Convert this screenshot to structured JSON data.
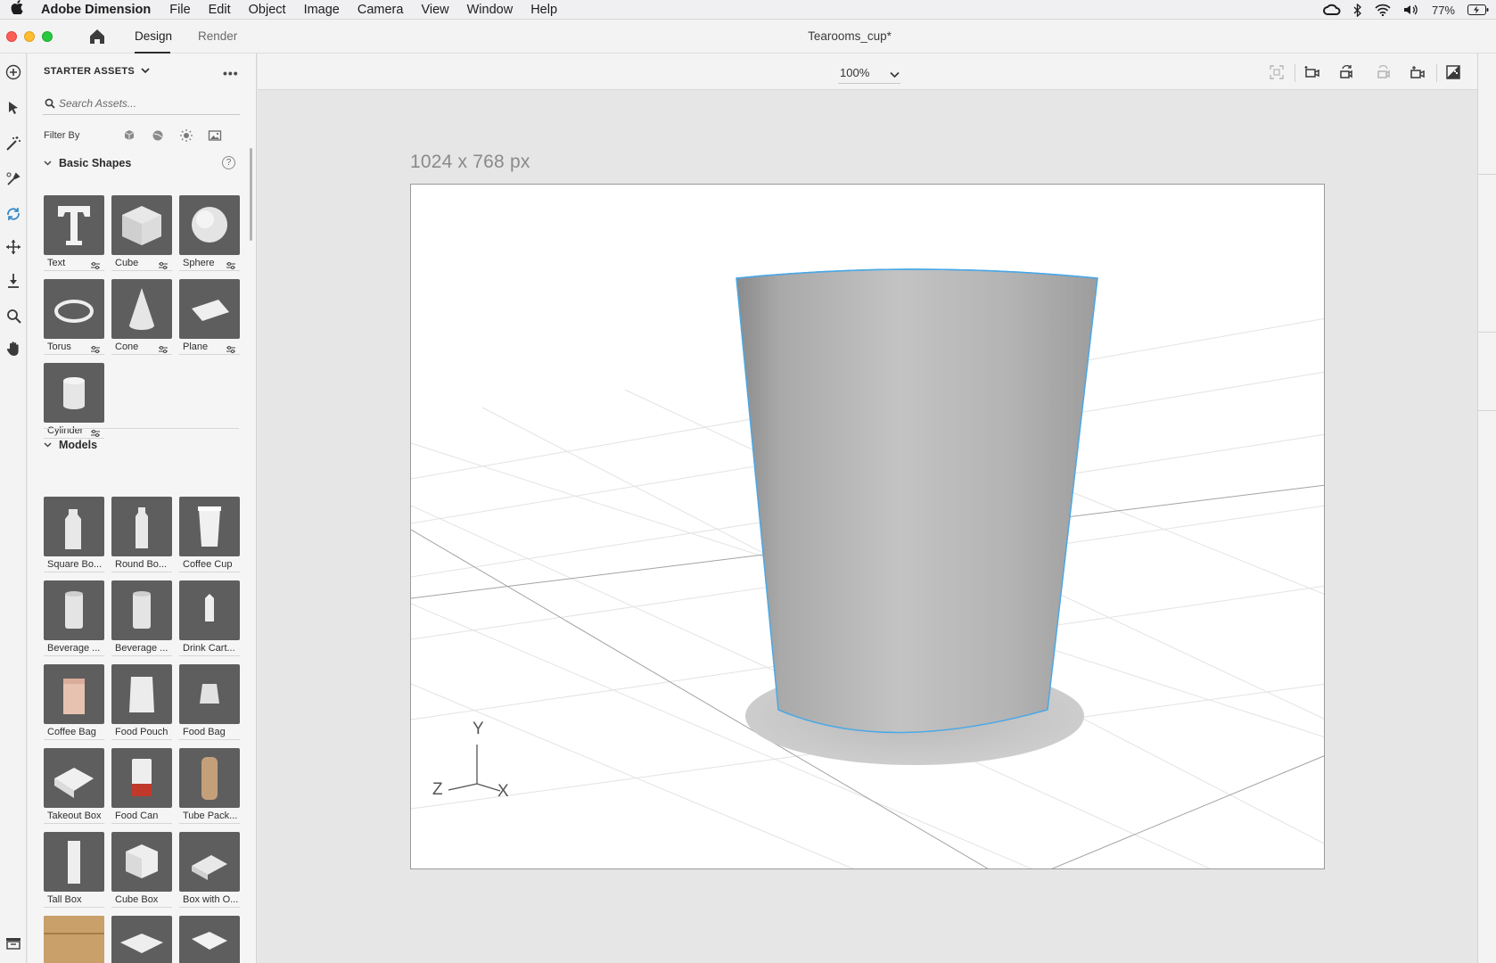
{
  "menubar": {
    "app_name": "Adobe Dimension",
    "items": [
      "File",
      "Edit",
      "Object",
      "Image",
      "Camera",
      "View",
      "Window",
      "Help"
    ],
    "battery": "77%"
  },
  "titlebar": {
    "tabs": {
      "design": "Design",
      "render": "Render"
    },
    "active_tab": "Design",
    "document_title": "Tearooms_cup*"
  },
  "assets": {
    "header": "STARTER ASSETS",
    "search_placeholder": "Search Assets...",
    "filter_label": "Filter By",
    "sections": {
      "basic_shapes": {
        "title": "Basic Shapes",
        "items": [
          "Text",
          "Cube",
          "Sphere",
          "Torus",
          "Cone",
          "Plane",
          "Cylinder"
        ]
      },
      "models": {
        "title": "Models",
        "items": [
          "Square Bo...",
          "Round Bo...",
          "Coffee Cup",
          "Beverage ...",
          "Beverage ...",
          "Drink Cart...",
          "Coffee Bag",
          "Food Pouch",
          "Food Bag",
          "Takeout Box",
          "Food Can",
          "Tube Pack...",
          "Tall Box",
          "Cube Box",
          "Box with O..."
        ]
      }
    }
  },
  "viewport": {
    "zoom": "100%",
    "canvas_size_label": "1024 x 768 px",
    "axes": {
      "x": "X",
      "y": "Y",
      "z": "Z"
    },
    "selection_color": "#4aa8e6"
  }
}
